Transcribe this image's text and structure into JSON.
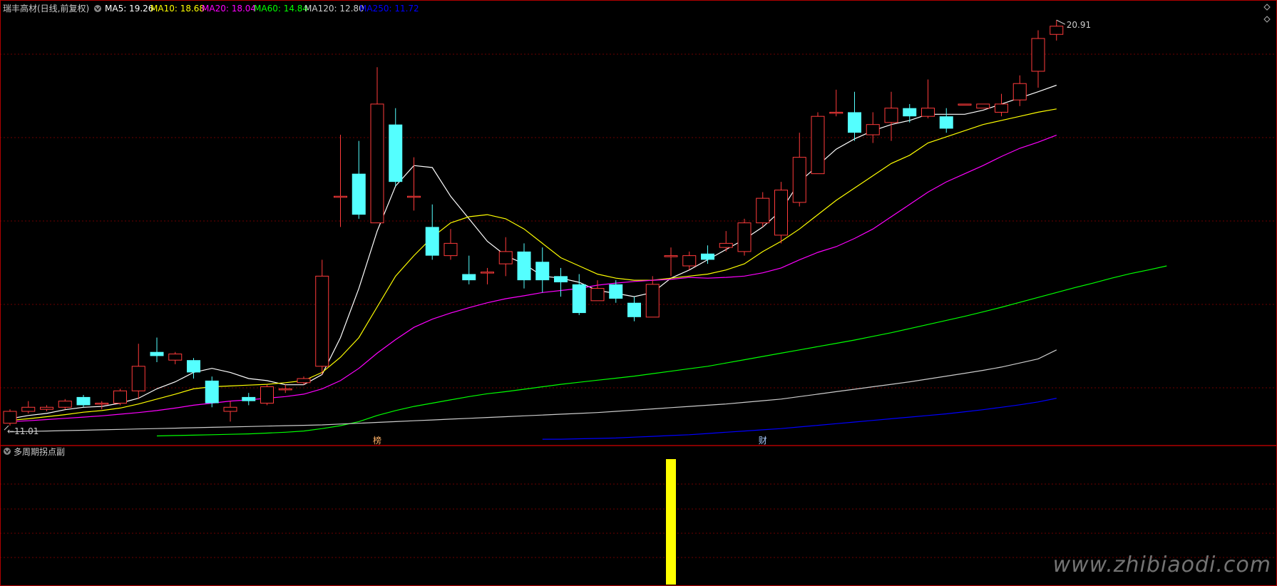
{
  "header": {
    "title": "瑞丰高材(日线,前复权)",
    "ma_labels": [
      {
        "name": "MA5",
        "text": "MA5: 19.26",
        "color": "#ffffff"
      },
      {
        "name": "MA10",
        "text": "MA10: 18.68",
        "color": "#ffff00"
      },
      {
        "name": "MA20",
        "text": "MA20: 18.04",
        "color": "#ff00ff"
      },
      {
        "name": "MA60",
        "text": "MA60: 14.84",
        "color": "#00ff00"
      },
      {
        "name": "MA120",
        "text": "MA120: 12.80",
        "color": "#cccccc"
      },
      {
        "name": "MA250",
        "text": "MA250: 11.72",
        "color": "#0000ff"
      }
    ]
  },
  "colors": {
    "up": "#ff3b3b",
    "down": "#54ffff",
    "grid": "#6e0000",
    "border": "#b00000",
    "text": "#cccccc",
    "indicator_bar": "#ffff00"
  },
  "chart_data": {
    "type": "candlestick",
    "price_range": [
      10.5,
      21.2
    ],
    "high_label": "20.91",
    "low_label": "11.01",
    "candles": [
      [
        11.01,
        11.3,
        10.95,
        11.35
      ],
      [
        11.3,
        11.4,
        11.25,
        11.55
      ],
      [
        11.35,
        11.4,
        11.3,
        11.45
      ],
      [
        11.4,
        11.55,
        11.35,
        11.6
      ],
      [
        11.65,
        11.45,
        11.4,
        11.7
      ],
      [
        11.5,
        11.5,
        11.35,
        11.55
      ],
      [
        11.5,
        11.8,
        11.45,
        11.85
      ],
      [
        11.8,
        12.4,
        11.6,
        12.95
      ],
      [
        12.75,
        12.65,
        12.5,
        13.1
      ],
      [
        12.55,
        12.7,
        12.45,
        12.75
      ],
      [
        12.55,
        12.25,
        12.1,
        12.6
      ],
      [
        12.05,
        11.5,
        11.4,
        12.15
      ],
      [
        11.3,
        11.4,
        11.05,
        11.55
      ],
      [
        11.65,
        11.55,
        11.45,
        11.75
      ],
      [
        11.5,
        11.9,
        11.45,
        11.95
      ],
      [
        11.85,
        11.85,
        11.75,
        11.95
      ],
      [
        12.0,
        12.1,
        11.95,
        12.15
      ],
      [
        12.4,
        14.6,
        12.2,
        15.0
      ],
      [
        16.55,
        16.55,
        15.8,
        18.05
      ],
      [
        17.1,
        16.1,
        16.0,
        17.9
      ],
      [
        15.9,
        18.8,
        15.9,
        19.7
      ],
      [
        18.3,
        16.9,
        16.8,
        18.7
      ],
      [
        16.55,
        16.55,
        16.2,
        17.5
      ],
      [
        15.8,
        15.1,
        15.0,
        16.35
      ],
      [
        15.1,
        15.4,
        15.0,
        15.75
      ],
      [
        14.65,
        14.5,
        14.4,
        15.1
      ],
      [
        14.7,
        14.7,
        14.4,
        14.8
      ],
      [
        14.9,
        15.2,
        14.6,
        15.55
      ],
      [
        15.2,
        14.5,
        14.3,
        15.4
      ],
      [
        14.95,
        14.5,
        14.2,
        15.3
      ],
      [
        14.6,
        14.45,
        14.1,
        14.8
      ],
      [
        14.4,
        13.7,
        13.65,
        14.65
      ],
      [
        14.0,
        14.3,
        14.0,
        14.5
      ],
      [
        14.4,
        14.05,
        13.95,
        14.5
      ],
      [
        13.95,
        13.6,
        13.5,
        14.1
      ],
      [
        13.6,
        14.4,
        13.6,
        14.6
      ],
      [
        15.1,
        15.1,
        14.6,
        15.3
      ],
      [
        14.85,
        15.1,
        14.75,
        15.2
      ],
      [
        15.15,
        15.0,
        14.9,
        15.35
      ],
      [
        15.3,
        15.4,
        15.2,
        15.7
      ],
      [
        15.2,
        15.9,
        15.1,
        16.0
      ],
      [
        15.9,
        16.5,
        15.8,
        16.65
      ],
      [
        15.6,
        16.7,
        15.4,
        16.9
      ],
      [
        16.4,
        17.5,
        16.3,
        18.1
      ],
      [
        17.1,
        18.5,
        17.1,
        18.6
      ],
      [
        18.6,
        18.6,
        18.5,
        19.15
      ],
      [
        18.6,
        18.1,
        17.9,
        19.1
      ],
      [
        18.05,
        18.3,
        17.85,
        18.6
      ],
      [
        18.35,
        18.7,
        17.9,
        19.1
      ],
      [
        18.7,
        18.5,
        18.35,
        18.8
      ],
      [
        18.5,
        18.7,
        18.45,
        19.4
      ],
      [
        18.5,
        18.2,
        18.1,
        18.7
      ],
      [
        18.8,
        18.8,
        18.8,
        18.8
      ],
      [
        18.7,
        18.8,
        18.7,
        18.8
      ],
      [
        18.6,
        18.8,
        18.5,
        19.05
      ],
      [
        18.9,
        19.3,
        18.75,
        19.5
      ],
      [
        19.6,
        20.4,
        19.2,
        20.6
      ],
      [
        20.5,
        20.7,
        20.35,
        20.85
      ]
    ],
    "ma_lines": [
      {
        "name": "MA5",
        "color": "#ffffff",
        "start": 0,
        "values": [
          11.12,
          11.2,
          11.25,
          11.34,
          11.4,
          11.42,
          11.5,
          11.62,
          11.85,
          12.02,
          12.25,
          12.35,
          12.25,
          12.1,
          12.05,
          11.95,
          11.95,
          12.2,
          13.1,
          14.3,
          15.7,
          16.8,
          17.3,
          17.25,
          16.55,
          16.0,
          15.45,
          15.1,
          14.9,
          14.6,
          14.55,
          14.45,
          14.25,
          14.18,
          14.1,
          14.2,
          14.55,
          14.75,
          15.0,
          15.25,
          15.5,
          15.8,
          16.2,
          16.9,
          17.3,
          17.7,
          17.95,
          18.15,
          18.3,
          18.4,
          18.55,
          18.55,
          18.55,
          18.65,
          18.8,
          18.95,
          19.1,
          19.26
        ]
      },
      {
        "name": "MA10",
        "color": "#ffff00",
        "start": 0,
        "values": [
          11.08,
          11.12,
          11.17,
          11.22,
          11.28,
          11.32,
          11.38,
          11.48,
          11.6,
          11.72,
          11.85,
          11.9,
          11.92,
          11.94,
          11.96,
          12.0,
          12.05,
          12.25,
          12.62,
          13.1,
          13.85,
          14.6,
          15.1,
          15.55,
          15.9,
          16.05,
          16.1,
          16.0,
          15.75,
          15.4,
          15.05,
          14.85,
          14.65,
          14.55,
          14.5,
          14.5,
          14.55,
          14.6,
          14.65,
          14.75,
          14.9,
          15.2,
          15.45,
          15.75,
          16.1,
          16.45,
          16.75,
          17.05,
          17.35,
          17.55,
          17.85,
          18.0,
          18.15,
          18.3,
          18.4,
          18.5,
          18.6,
          18.68
        ]
      },
      {
        "name": "MA20",
        "color": "#ff00ff",
        "start": 0,
        "values": [
          11.05,
          11.07,
          11.1,
          11.13,
          11.16,
          11.19,
          11.23,
          11.27,
          11.32,
          11.38,
          11.45,
          11.5,
          11.55,
          11.58,
          11.62,
          11.66,
          11.72,
          11.85,
          12.05,
          12.35,
          12.72,
          13.05,
          13.35,
          13.55,
          13.7,
          13.83,
          13.95,
          14.05,
          14.12,
          14.2,
          14.25,
          14.3,
          14.38,
          14.43,
          14.47,
          14.5,
          14.52,
          14.57,
          14.55,
          14.57,
          14.6,
          14.68,
          14.8,
          15.0,
          15.18,
          15.32,
          15.52,
          15.75,
          16.05,
          16.35,
          16.65,
          16.9,
          17.1,
          17.3,
          17.52,
          17.72,
          17.87,
          18.04
        ]
      },
      {
        "name": "MA60",
        "color": "#00ff00",
        "start": 8,
        "values": [
          10.7,
          10.71,
          10.72,
          10.73,
          10.74,
          10.75,
          10.77,
          10.79,
          10.82,
          10.88,
          10.95,
          11.05,
          11.2,
          11.32,
          11.42,
          11.5,
          11.58,
          11.66,
          11.73,
          11.78,
          11.84,
          11.9,
          11.96,
          12.01,
          12.06,
          12.11,
          12.16,
          12.22,
          12.28,
          12.34,
          12.4,
          12.48,
          12.56,
          12.64,
          12.72,
          12.8,
          12.88,
          12.96,
          13.04,
          13.13,
          13.22,
          13.32,
          13.42,
          13.52,
          13.62,
          13.73,
          13.84,
          13.96,
          14.08,
          14.2,
          14.32,
          14.43,
          14.55,
          14.66,
          14.75,
          14.85
        ]
      },
      {
        "name": "MA120",
        "color": "#cccccc",
        "start": 0,
        "values": [
          10.8,
          10.81,
          10.82,
          10.83,
          10.84,
          10.85,
          10.86,
          10.87,
          10.88,
          10.89,
          10.9,
          10.91,
          10.92,
          10.93,
          10.94,
          10.95,
          10.96,
          10.97,
          10.99,
          11.01,
          11.03,
          11.05,
          11.07,
          11.09,
          11.11,
          11.13,
          11.15,
          11.17,
          11.19,
          11.21,
          11.23,
          11.25,
          11.27,
          11.3,
          11.33,
          11.36,
          11.39,
          11.42,
          11.45,
          11.48,
          11.52,
          11.56,
          11.6,
          11.66,
          11.72,
          11.78,
          11.84,
          11.9,
          11.96,
          12.02,
          12.09,
          12.16,
          12.23,
          12.3,
          12.38,
          12.48,
          12.58,
          12.8
        ]
      },
      {
        "name": "MA250",
        "color": "#0000ff",
        "start": 29,
        "values": [
          10.62,
          10.62,
          10.63,
          10.64,
          10.65,
          10.67,
          10.69,
          10.71,
          10.73,
          10.76,
          10.79,
          10.82,
          10.85,
          10.88,
          10.92,
          10.96,
          11.0,
          11.04,
          11.08,
          11.12,
          11.16,
          11.2,
          11.24,
          11.29,
          11.34,
          11.4,
          11.46,
          11.53,
          11.62
        ]
      }
    ],
    "markers": [
      {
        "index": 20,
        "text": "榜",
        "color": "#ffb066"
      },
      {
        "index": 41,
        "text": "财",
        "color": "#aaccff"
      }
    ],
    "indicator": {
      "title": "多周期拐点副",
      "bar_index": 36,
      "bar_value": 1
    }
  },
  "watermark": "www.zhibiaodi.com"
}
